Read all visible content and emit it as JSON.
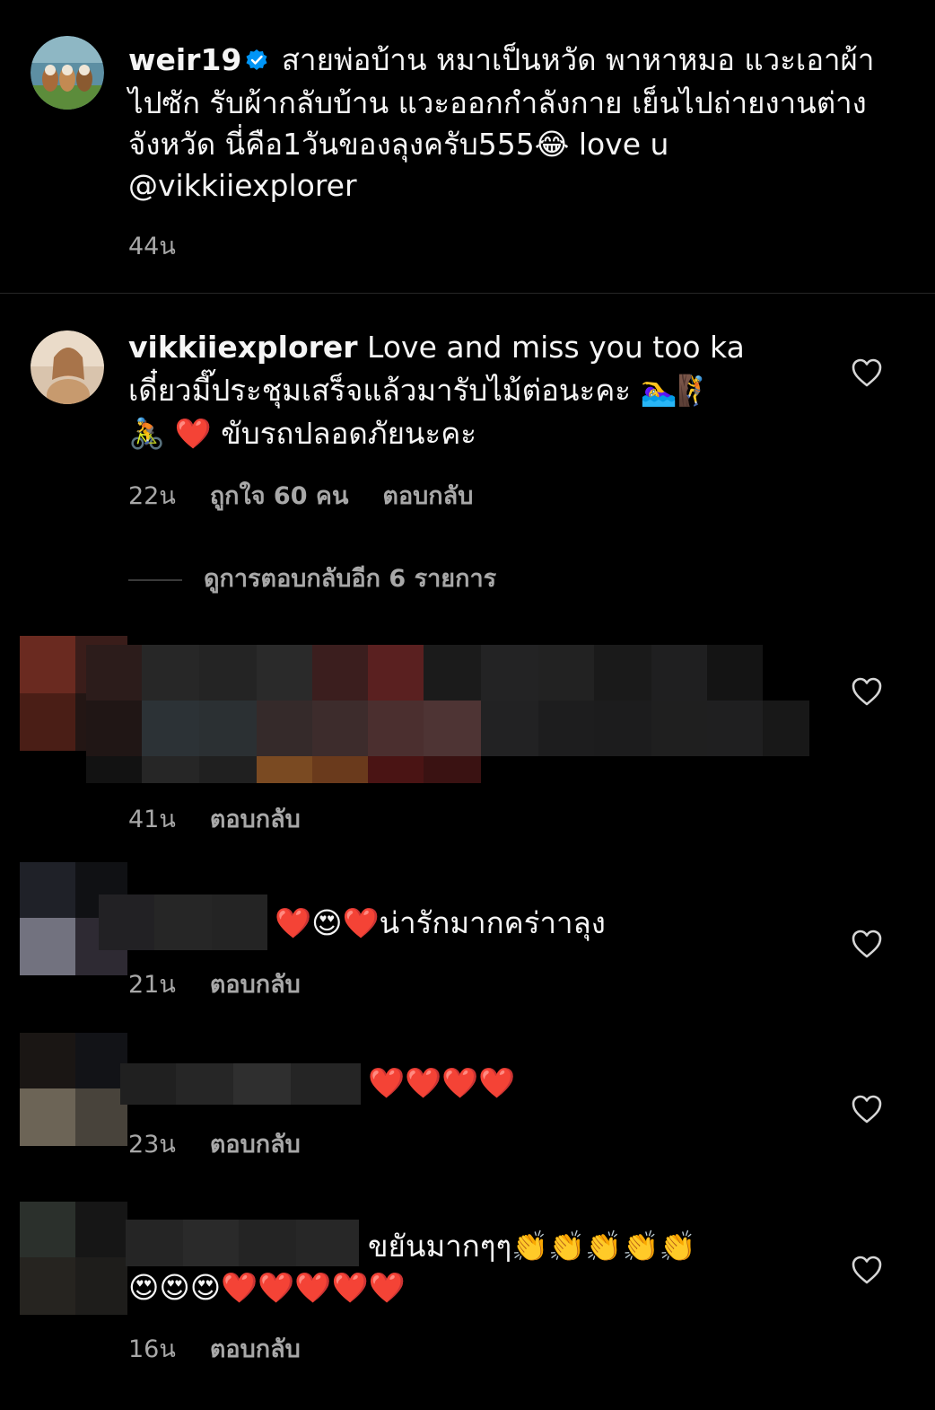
{
  "post": {
    "username": "weir19",
    "caption": "สายพ่อบ้าน หมาเป็นหวัด พาหาหมอ แวะเอาผ้าไปซัก รับผ้ากลับบ้าน แวะออกกำลังกาย เย็นไปถ่ายงานต่างจังหวัด นี่คือ1วันของลุงครับ555",
    "caption_tail": " love u",
    "mention": "@vikkiiexplorer",
    "time": "44น",
    "emoji_laugh": "😂"
  },
  "comments": [
    {
      "username": "vikkiiexplorer",
      "text_line1": "Love and miss you too ka",
      "text_line2": "เดี๋ยวมี๊ประชุมเสร็จแล้วมารับไม้ต่อนะคะ",
      "emoji_a": "🏊‍♀️",
      "emoji_b": "🧗",
      "emoji_c": "🚴",
      "emoji_heart": "❤️",
      "text_line3": "ขับรถปลอดภัยนะคะ",
      "time": "22น",
      "likes": "ถูกใจ 60 คน",
      "reply": "ตอบกลับ"
    },
    {
      "time": "41น",
      "reply": "ตอบกลับ"
    },
    {
      "emojis": "❤️😍❤️",
      "text": "น่ารักมากคร่าาลุง",
      "time": "21น",
      "reply": "ตอบกลับ"
    },
    {
      "emojis": "❤️❤️❤️❤️",
      "time": "23น",
      "reply": "ตอบกลับ"
    },
    {
      "text": "ขยันมากๆๆ",
      "emojis_line1": "👏👏👏👏👏",
      "emojis_line2": "😍😍😍❤️❤️❤️❤️❤️",
      "time": "16น",
      "reply": "ตอบกลับ"
    }
  ],
  "view_more_replies": "ดูการตอบกลับอีก 6 รายการ",
  "colors": {
    "background": "#000000",
    "text": "#f5f5f5",
    "secondary": "#a8a8a8",
    "verified": "#0095f6"
  }
}
